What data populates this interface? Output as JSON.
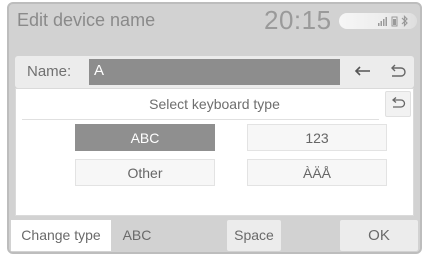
{
  "header": {
    "title": "Edit device name",
    "time": "20:15",
    "status_icons": [
      "signal-icon",
      "battery-icon",
      "bluetooth-icon"
    ]
  },
  "name_row": {
    "label": "Name:",
    "value": "A"
  },
  "keyboard_panel": {
    "title": "Select keyboard type",
    "options": [
      "ABC",
      "123",
      "Other",
      "ÀÄÅ"
    ],
    "selected": "ABC"
  },
  "bottom_bar": {
    "change_type": "Change type",
    "abc": "ABC",
    "space": "Space",
    "ok": "OK"
  },
  "colors": {
    "background": "#d2d2d2",
    "selected": "#8f8f8f",
    "panel": "#ffffff"
  }
}
